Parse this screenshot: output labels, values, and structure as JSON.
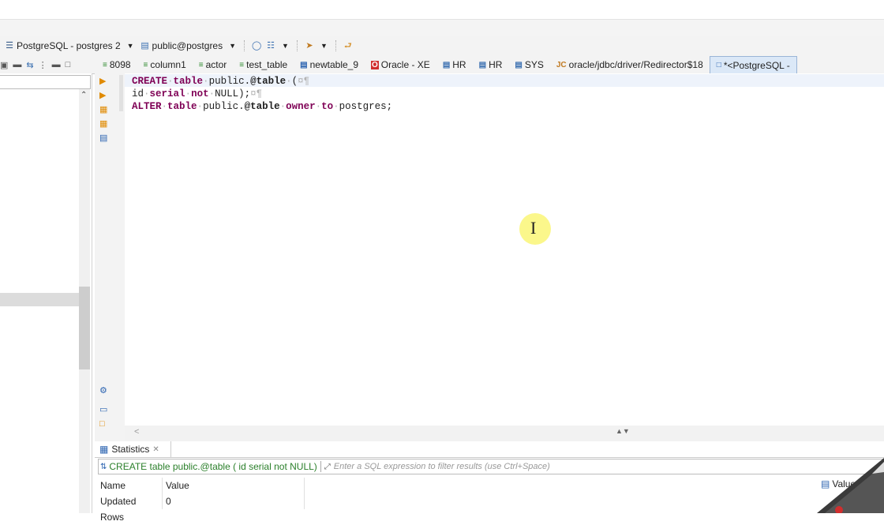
{
  "toolbar": {
    "connection": "PostgreSQL - postgres 2",
    "schema": "public@postgres"
  },
  "tabs": [
    {
      "label": "8098",
      "icon": "sql-icon"
    },
    {
      "label": "column1",
      "icon": "sql-icon"
    },
    {
      "label": "actor",
      "icon": "sql-icon"
    },
    {
      "label": "test_table",
      "icon": "sql-icon"
    },
    {
      "label": "newtable_9",
      "icon": "table-icon"
    },
    {
      "label": "Oracle - XE",
      "icon": "oracle-icon"
    },
    {
      "label": "HR",
      "icon": "schema-icon"
    },
    {
      "label": "HR",
      "icon": "schema-icon"
    },
    {
      "label": "SYS",
      "icon": "schema-icon"
    },
    {
      "label": "oracle/jdbc/driver/Redirector$18",
      "icon": "java-class-icon"
    },
    {
      "label": "*<PostgreSQL -",
      "icon": "sql-editor-icon"
    }
  ],
  "editor": {
    "line1": {
      "kw1": "CREATE",
      "kw2": "table",
      "ident": "public.",
      "bold": "@table",
      "paren": "("
    },
    "line2": {
      "id": "id",
      "kw1": "serial",
      "kw2": "not",
      "rest": "NULL);"
    },
    "line3": {
      "kw1": "ALTER",
      "kw2": "table",
      "ident": "public.",
      "bold": "@table",
      "kw3": "owner",
      "kw4": "to",
      "rest": "postgres;"
    }
  },
  "results": {
    "tab_label": "Statistics",
    "query_text": "CREATE table public.@table ( id serial not NULL)",
    "filter_placeholder": "Enter a SQL expression to filter results (use Ctrl+Space)",
    "columns": [
      "Name",
      "Value"
    ],
    "rows": [
      {
        "name": "Updated Rows",
        "value": "0"
      }
    ],
    "value_button": "Value"
  },
  "colors": {
    "keyword": "#7f0055",
    "active_tab": "#dbe8f7",
    "cursor_halo": "#fbf78b"
  }
}
